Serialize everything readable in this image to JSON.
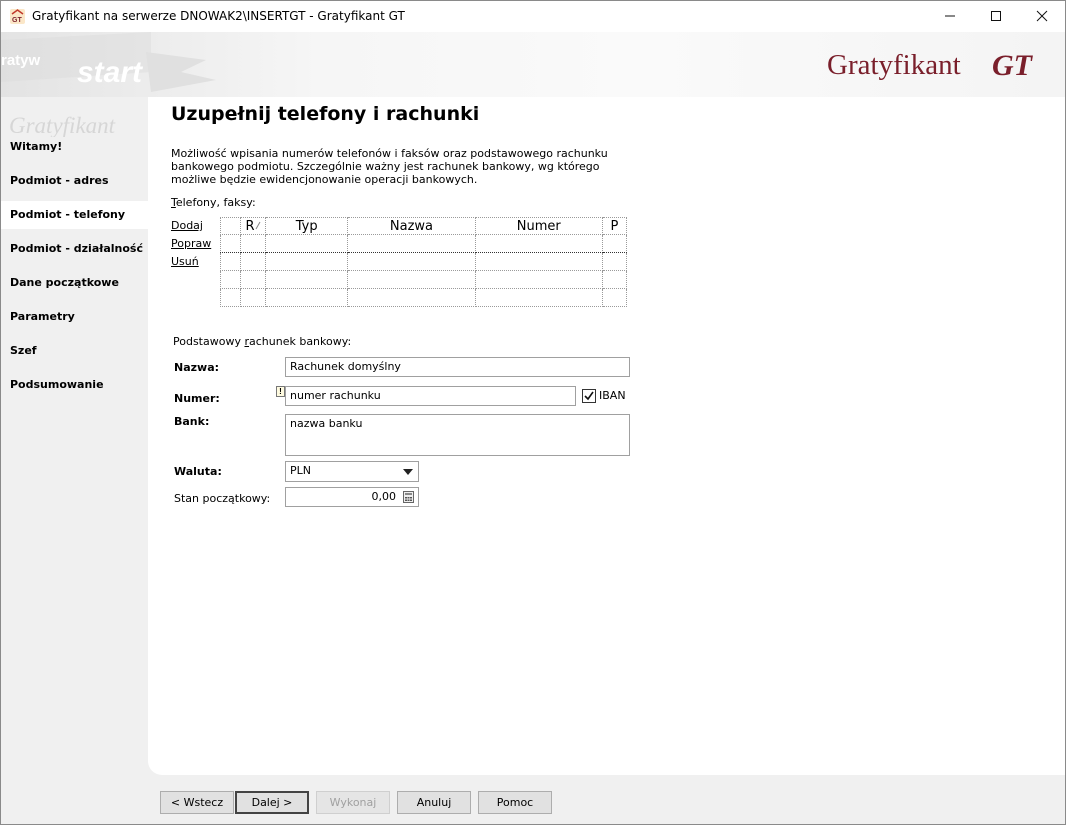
{
  "window": {
    "title": "Gratyfikant na serwerze DNOWAK2\\INSERTGT - Gratyfikant GT",
    "icon": "gt-app-icon",
    "controls": [
      "minimize-icon",
      "maximize-icon",
      "close-icon"
    ]
  },
  "header": {
    "brand_text": "Gratyfikant",
    "brand_suffix": "GT",
    "brand_color": "#7a1f2b",
    "deco_start": "start",
    "deco_brand": "Gratyfikant",
    "deco_prefix": "ratyw"
  },
  "sidebar": {
    "items": [
      {
        "label": "Witamy!",
        "active": false
      },
      {
        "label": "Podmiot - adres",
        "active": false
      },
      {
        "label": "Podmiot - telefony",
        "active": true
      },
      {
        "label": "Podmiot - działalność",
        "active": false
      },
      {
        "label": "Dane początkowe",
        "active": false
      },
      {
        "label": "Parametry",
        "active": false
      },
      {
        "label": "Szef",
        "active": false
      },
      {
        "label": "Podsumowanie",
        "active": false
      }
    ]
  },
  "page": {
    "title": "Uzupełnij telefony i rachunki",
    "description": "Możliwość wpisania numerów telefonów i faksów oraz podstawowego rachunku bankowego podmiotu. Szczególnie ważny jest rachunek bankowy, wg którego możliwe będzie ewidencjonowanie operacji bankowych."
  },
  "phones": {
    "label_first": "T",
    "label_rest": "elefony, faksy:",
    "actions": [
      "Dodaj",
      "Popraw",
      "Usuń"
    ],
    "columns": [
      "",
      "R",
      "Typ",
      "Nazwa",
      "Numer",
      "P"
    ],
    "rows": 4
  },
  "bank": {
    "section_label_a": "Podstawowy ",
    "section_label_u": "r",
    "section_label_b": "achunek bankowy:",
    "name_label": "Nazwa:",
    "name_value": "Rachunek domyślny",
    "number_label": "Numer:",
    "number_value": "numer rachunku",
    "iban_label": "IBAN",
    "iban_checked": true,
    "bank_label": "Bank:",
    "bank_value": "nazwa banku",
    "currency_label": "Waluta:",
    "currency_value": "PLN",
    "balance_label": "Stan początkowy:",
    "balance_value": "0,00"
  },
  "buttons": {
    "back": "< Wstecz",
    "next": "Dalej >",
    "execute": "Wykonaj",
    "cancel": "Anuluj",
    "help": "Pomoc"
  }
}
